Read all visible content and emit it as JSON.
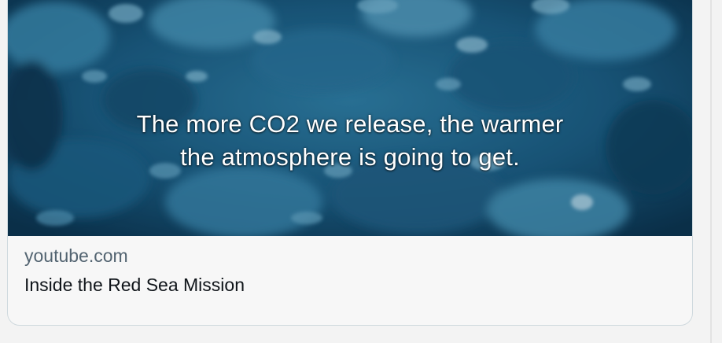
{
  "card": {
    "media": {
      "caption_line_1": "The more CO2 we release, the warmer",
      "caption_line_2": "the atmosphere is going to get."
    },
    "domain": "youtube.com",
    "title": "Inside the Red Sea Mission"
  },
  "colors": {
    "page_background": "#f3f3f3",
    "card_border": "#cfd9de",
    "domain_text": "#536471",
    "title_text": "#0f1419",
    "water_dark": "#0d3f5d",
    "water_light": "#5fa6c4"
  }
}
